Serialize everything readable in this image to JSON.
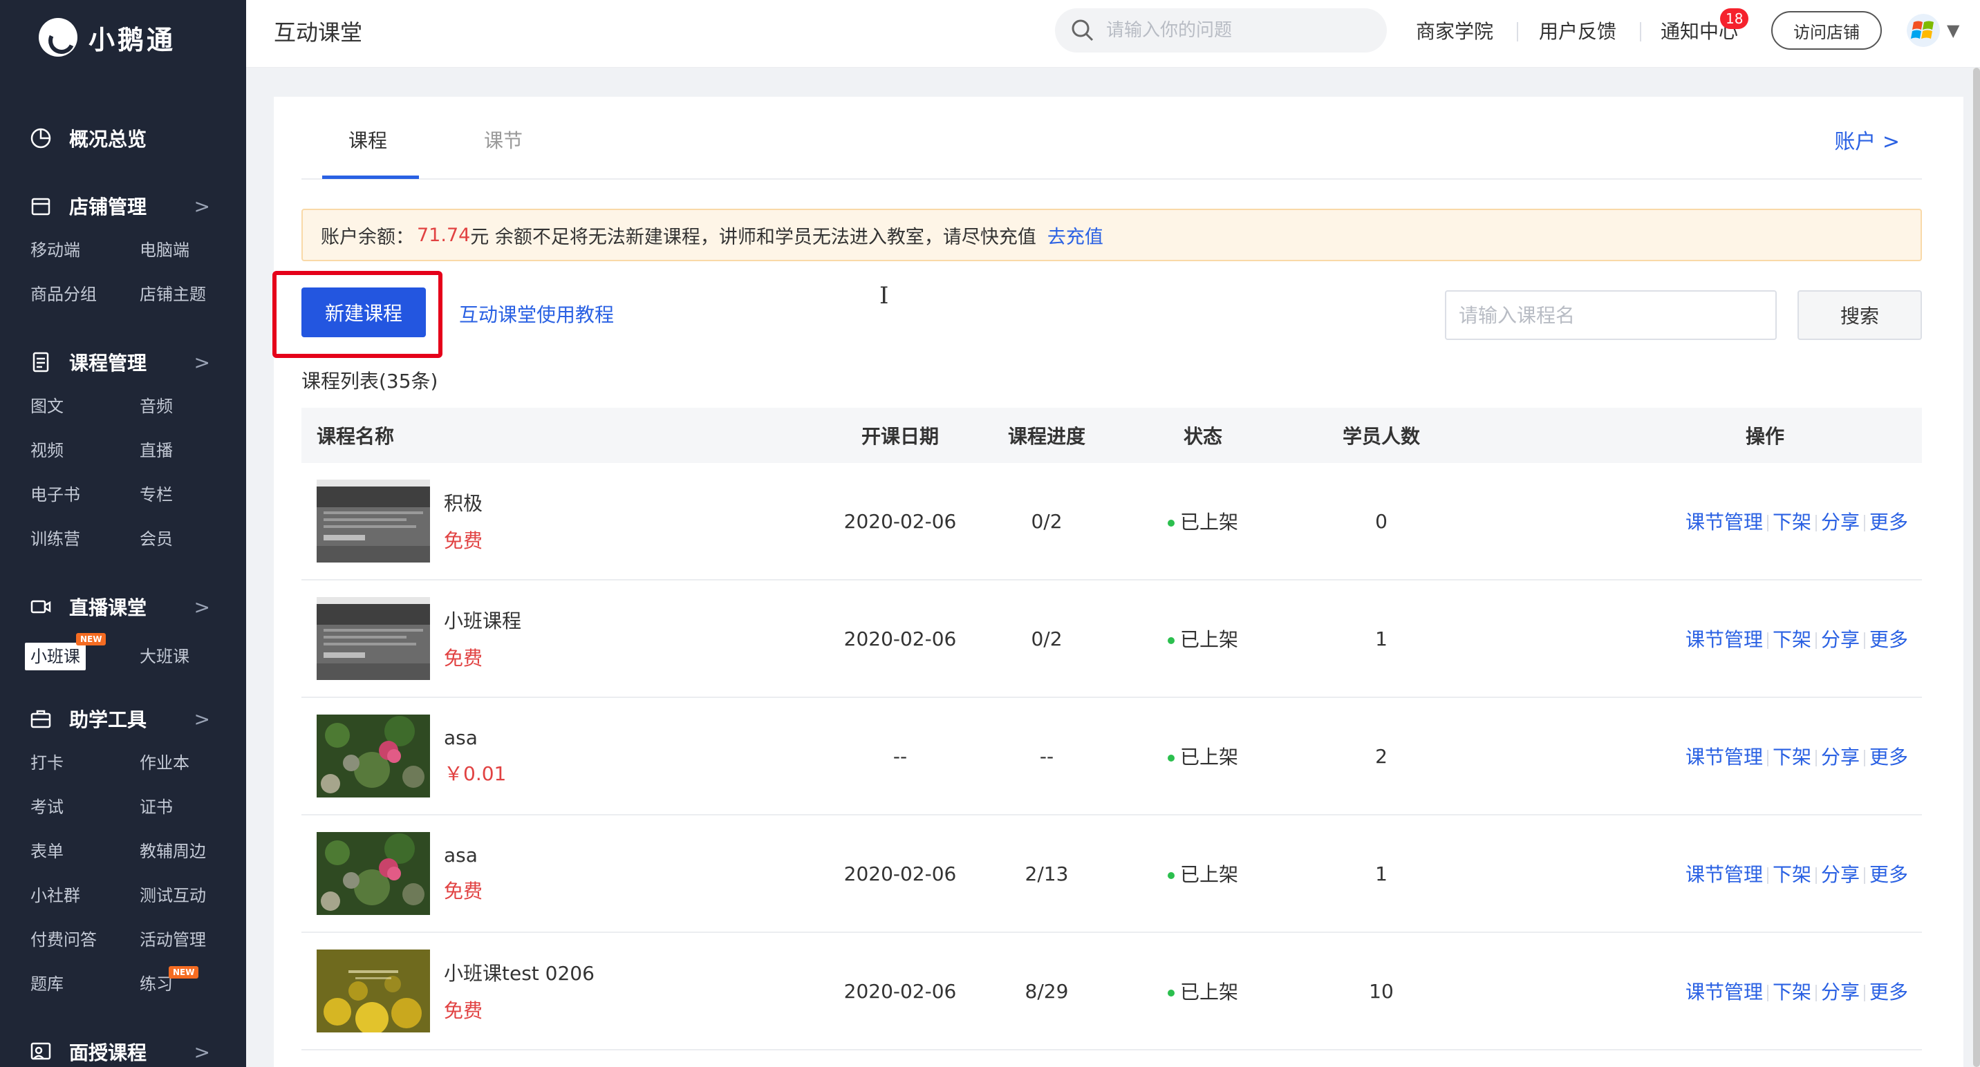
{
  "brand": {
    "name": "小鹅通"
  },
  "sidebar": {
    "sections": [
      {
        "label": "概况总览",
        "icon": "chart-icon",
        "items": []
      },
      {
        "label": "店铺管理",
        "icon": "store-icon",
        "items": [
          "移动端",
          "电脑端",
          "商品分组",
          "店铺主题"
        ]
      },
      {
        "label": "课程管理",
        "icon": "document-icon",
        "items": [
          "图文",
          "音频",
          "视频",
          "直播",
          "电子书",
          "专栏",
          "训练营",
          "会员"
        ]
      },
      {
        "label": "直播课堂",
        "icon": "camera-icon",
        "items": [
          "小班课",
          "大班课"
        ]
      },
      {
        "label": "助学工具",
        "icon": "toolbox-icon",
        "items": [
          "打卡",
          "作业本",
          "考试",
          "证书",
          "表单",
          "教辅周边",
          "小社群",
          "测试互动",
          "付费问答",
          "活动管理",
          "题库",
          "练习"
        ]
      },
      {
        "label": "面授课程",
        "icon": "teacher-icon",
        "items": []
      }
    ],
    "new_badge": "NEW"
  },
  "topbar": {
    "title": "互动课堂",
    "search_placeholder": "请输入你的问题",
    "links": [
      "商家学院",
      "用户反馈",
      "通知中心"
    ],
    "notification_count": "18",
    "visit_store": "访问店铺"
  },
  "main": {
    "tabs": [
      "课程",
      "课节"
    ],
    "account_link": "账户 >",
    "alert": {
      "prefix": "账户余额：",
      "amount": "71.74",
      "text": "元 余额不足将无法新建课程，讲师和学员无法进入教室，请尽快充值",
      "link": "去充值"
    },
    "new_course_button": "新建课程",
    "tutorial_link": "互动课堂使用教程",
    "course_search_placeholder": "请输入课程名",
    "search_button": "搜索",
    "list_count": "课程列表(35条)",
    "table": {
      "headers": [
        "课程名称",
        "开课日期",
        "课程进度",
        "状态",
        "学员人数",
        "操作"
      ],
      "rows": [
        {
          "name": "积极",
          "price": "免费",
          "date": "2020-02-06",
          "progress": "0/2",
          "status": "已上架",
          "students": "0",
          "thumb": "screenshot"
        },
        {
          "name": "小班课程",
          "price": "免费",
          "date": "2020-02-06",
          "progress": "0/2",
          "status": "已上架",
          "students": "1",
          "thumb": "screenshot"
        },
        {
          "name": "asa",
          "price": "￥0.01",
          "date": "--",
          "progress": "--",
          "status": "已上架",
          "students": "2",
          "thumb": "flowers"
        },
        {
          "name": "asa",
          "price": "免费",
          "date": "2020-02-06",
          "progress": "2/13",
          "status": "已上架",
          "students": "1",
          "thumb": "flowers"
        },
        {
          "name": "小班课test   0206",
          "price": "免费",
          "date": "2020-02-06",
          "progress": "8/29",
          "status": "已上架",
          "students": "10",
          "thumb": "yellow"
        }
      ],
      "ops": [
        "课节管理",
        "下架",
        "分享",
        "更多"
      ]
    }
  },
  "colors": {
    "accent": "#2a61e3",
    "sidebar_bg": "#1f2636",
    "price_red": "#e14242",
    "status_green": "#2bbf4e",
    "highlight_red": "#e5001a"
  }
}
